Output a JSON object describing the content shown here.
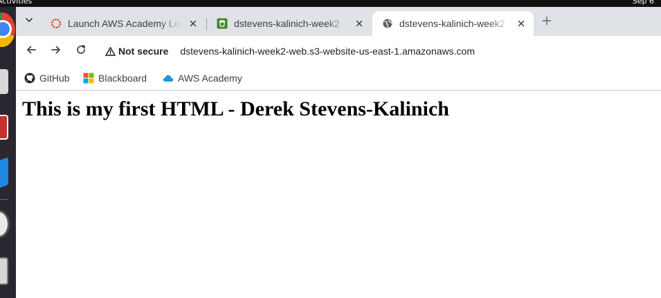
{
  "os": {
    "activities_label": "Activities",
    "clock": "Sep 6"
  },
  "tabs": [
    {
      "title": "Launch AWS Academy Learner Lab",
      "favicon": "aws-academy-ring-icon",
      "active": false
    },
    {
      "title": "dstevens-kalinich-week2",
      "favicon": "s3-bucket-icon",
      "active": false
    },
    {
      "title": "dstevens-kalinich-week2",
      "favicon": "globe-icon",
      "active": true
    }
  ],
  "toolbar": {
    "security_label": "Not secure",
    "url": "dstevens-kalinich-week2-web.s3-website-us-east-1.amazonaws.com"
  },
  "bookmarks": [
    {
      "label": "GitHub",
      "icon": "github-icon"
    },
    {
      "label": "Blackboard",
      "icon": "blackboard-icon"
    },
    {
      "label": "AWS Academy",
      "icon": "cloud-icon"
    }
  ],
  "page": {
    "heading": "This is my first HTML - Derek Stevens-Kalinich"
  },
  "colors": {
    "tabstrip_bg": "#dfe3e7",
    "dock_bg": "#2b2730",
    "topbar_bg": "#111111",
    "aws_ring": "#d13212",
    "s3_green": "#3f8624"
  }
}
